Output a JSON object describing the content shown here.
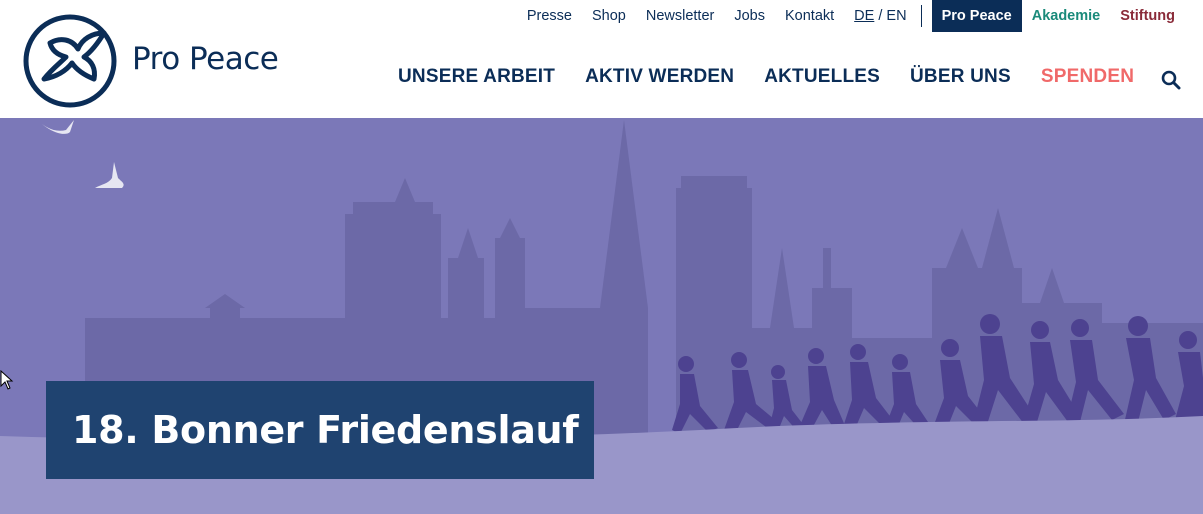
{
  "brand": {
    "logo_text": "Pro Peace",
    "color_primary": "#0b2d57"
  },
  "utility_nav": {
    "links": [
      "Presse",
      "Shop",
      "Newsletter",
      "Jobs",
      "Kontakt"
    ],
    "lang_current": "DE",
    "lang_separator": " / ",
    "lang_other": "EN",
    "tabs": {
      "pro_peace": "Pro Peace",
      "akademie": "Akademie",
      "stiftung": "Stiftung"
    }
  },
  "main_nav": {
    "items": [
      "UNSERE ARBEIT",
      "AKTIV WERDEN",
      "AKTUELLES",
      "ÜBER UNS"
    ],
    "donate": "SPENDEN",
    "search_icon": "search-icon"
  },
  "hero": {
    "title": "18. Bonner Friedenslauf",
    "image": "bonn-skyline-with-runners-illustration"
  },
  "colors": {
    "donate": "#f06969",
    "akademie": "#1a8a7a",
    "stiftung": "#8a2b39",
    "hero_bg": "#7b78b8",
    "title_box": "#1f4370"
  }
}
